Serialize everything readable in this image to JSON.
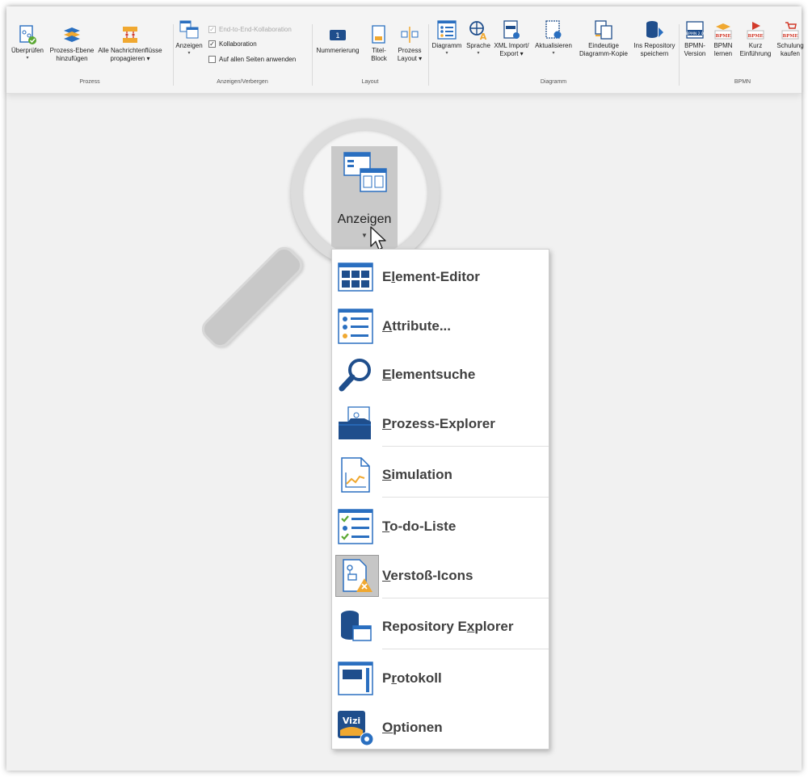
{
  "ribbon": {
    "groups": {
      "prozess": "Prozess",
      "anzeigen": "Anzeigen/Verbergen",
      "layout": "Layout",
      "diagramm": "Diagramm",
      "bpmn": "BPMN"
    },
    "buttons": {
      "ueberpruefen": "Überprüfen",
      "prozess_ebene_1": "Prozess-Ebene",
      "prozess_ebene_2": "hinzufügen",
      "alle": "Alle",
      "nachrichten_1": "Nachrichtenflüsse",
      "nachrichten_2": "propagieren",
      "anzeigen": "Anzeigen",
      "nummerierung": "Nummerierung",
      "titel_1": "Titel-",
      "titel_2": "Block",
      "prozess_layout_1": "Prozess",
      "prozess_layout_2": "Layout",
      "diagramm": "Diagramm",
      "sprache": "Sprache",
      "xml_1": "XML Import/",
      "xml_2": "Export",
      "aktualisieren": "Aktualisieren",
      "eindeutige_1": "Eindeutige",
      "eindeutige_2": "Diagramm-Kopie",
      "repo_1": "Ins Repository",
      "repo_2": "speichern",
      "bpmn_version_1": "BPMN-",
      "bpmn_version_2": "Version",
      "bpmn_lernen_1": "BPMN",
      "bpmn_lernen_2": "lernen",
      "kurz_1": "Kurz",
      "kurz_2": "Einführung",
      "schulung_1": "Schulung",
      "schulung_2": "kaufen"
    },
    "checkboxes": {
      "end_to_end": "End-to-End-Kollaboration",
      "kollaboration": "Kollaboration",
      "alle_seiten": "Auf allen Seiten anwenden"
    },
    "icon_badges": {
      "bpmn_20": "BPMN 2.0",
      "bpme": "BPME"
    }
  },
  "magnifier": {
    "label": "Anzeigen"
  },
  "menu": {
    "items": [
      {
        "pre": "E",
        "ak": "l",
        "post": "ement-Editor",
        "icon": "element-editor-icon"
      },
      {
        "pre": "",
        "ak": "A",
        "post": "ttribute...",
        "icon": "attributes-icon"
      },
      {
        "pre": "",
        "ak": "E",
        "post": "lementsuche",
        "icon": "search-icon"
      },
      {
        "pre": "",
        "ak": "P",
        "post": "rozess-Explorer",
        "icon": "process-explorer-icon"
      },
      {
        "pre": "",
        "ak": "S",
        "post": "imulation",
        "icon": "simulation-icon"
      },
      {
        "pre": "",
        "ak": "T",
        "post": "o-do-Liste",
        "icon": "todo-list-icon"
      },
      {
        "pre": "",
        "ak": "V",
        "post": "erstoß-Icons",
        "icon": "violation-icons-icon"
      },
      {
        "pre": "Repository E",
        "ak": "x",
        "post": "plorer",
        "icon": "repository-explorer-icon"
      },
      {
        "pre": "P",
        "ak": "r",
        "post": "otokoll",
        "icon": "protocol-icon"
      },
      {
        "pre": "",
        "ak": "O",
        "post": "ptionen",
        "icon": "options-icon"
      }
    ],
    "vizi_badge": "Vizi"
  },
  "colors": {
    "accent_blue": "#2a6fc0",
    "dark_blue": "#1f4e8c",
    "green": "#5aa832",
    "orange": "#f0a830",
    "red": "#d23a2a"
  }
}
